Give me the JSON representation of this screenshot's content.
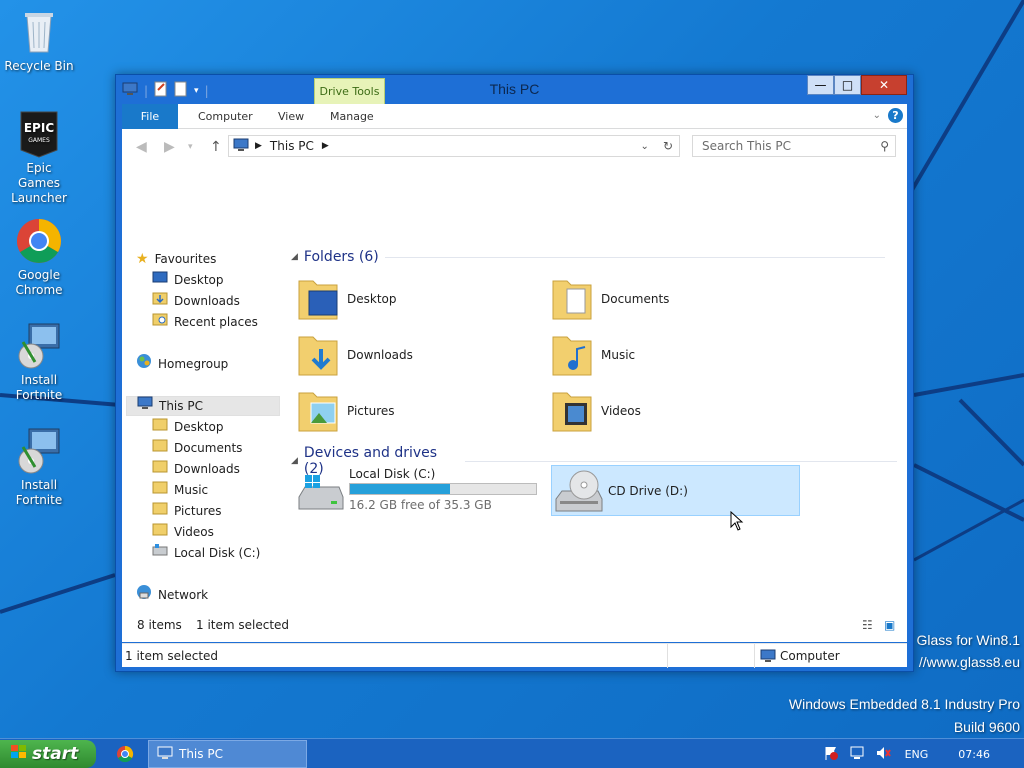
{
  "desktop": {
    "icons": [
      {
        "label": "Recycle Bin"
      },
      {
        "label": "Epic Games Launcher"
      },
      {
        "label": "Google Chrome"
      },
      {
        "label": "Install Fortnite"
      },
      {
        "label": "Install Fortnite"
      }
    ],
    "watermark": {
      "line1": "Glass for Win8.1",
      "line2": "//www.glass8.eu",
      "line3": "Windows Embedded 8.1 Industry Pro",
      "line4": "Build 9600"
    }
  },
  "window": {
    "title": "This PC",
    "contextual_tab": "Drive Tools",
    "tabs": {
      "file": "File",
      "computer": "Computer",
      "view": "View",
      "manage": "Manage"
    },
    "controls": {
      "minimize": "—",
      "maximize": "□",
      "close": "✕"
    },
    "address": {
      "path": "This PC"
    },
    "search": {
      "placeholder": "Search This PC"
    },
    "navigation": {
      "favourites": "Favourites",
      "fav_items": [
        "Desktop",
        "Downloads",
        "Recent places"
      ],
      "homegroup": "Homegroup",
      "this_pc": "This PC",
      "pc_items": [
        "Desktop",
        "Documents",
        "Downloads",
        "Music",
        "Pictures",
        "Videos",
        "Local Disk (C:)"
      ],
      "network": "Network"
    },
    "folders": {
      "header": "Folders (6)",
      "items": [
        "Desktop",
        "Documents",
        "Downloads",
        "Music",
        "Pictures",
        "Videos"
      ]
    },
    "devices": {
      "header": "Devices and drives (2)",
      "local_disk": {
        "name": "Local Disk (C:)",
        "free": "16.2 GB free of 35.3 GB",
        "used_fraction": 0.54
      },
      "cd_drive": {
        "name": "CD Drive (D:)"
      }
    },
    "status": {
      "items": "8 items",
      "selected": "1 item selected"
    },
    "details_bar": {
      "selected": "1 item selected",
      "location": "Computer"
    }
  },
  "taskbar": {
    "start": "start",
    "task": "This PC",
    "tray": {
      "lang": "ENG",
      "time": "07:46"
    }
  },
  "colors": {
    "accent": "#1979ca",
    "selection": "#cce8ff",
    "drive_bar": "#26a0da",
    "group_header": "#1e3287"
  }
}
